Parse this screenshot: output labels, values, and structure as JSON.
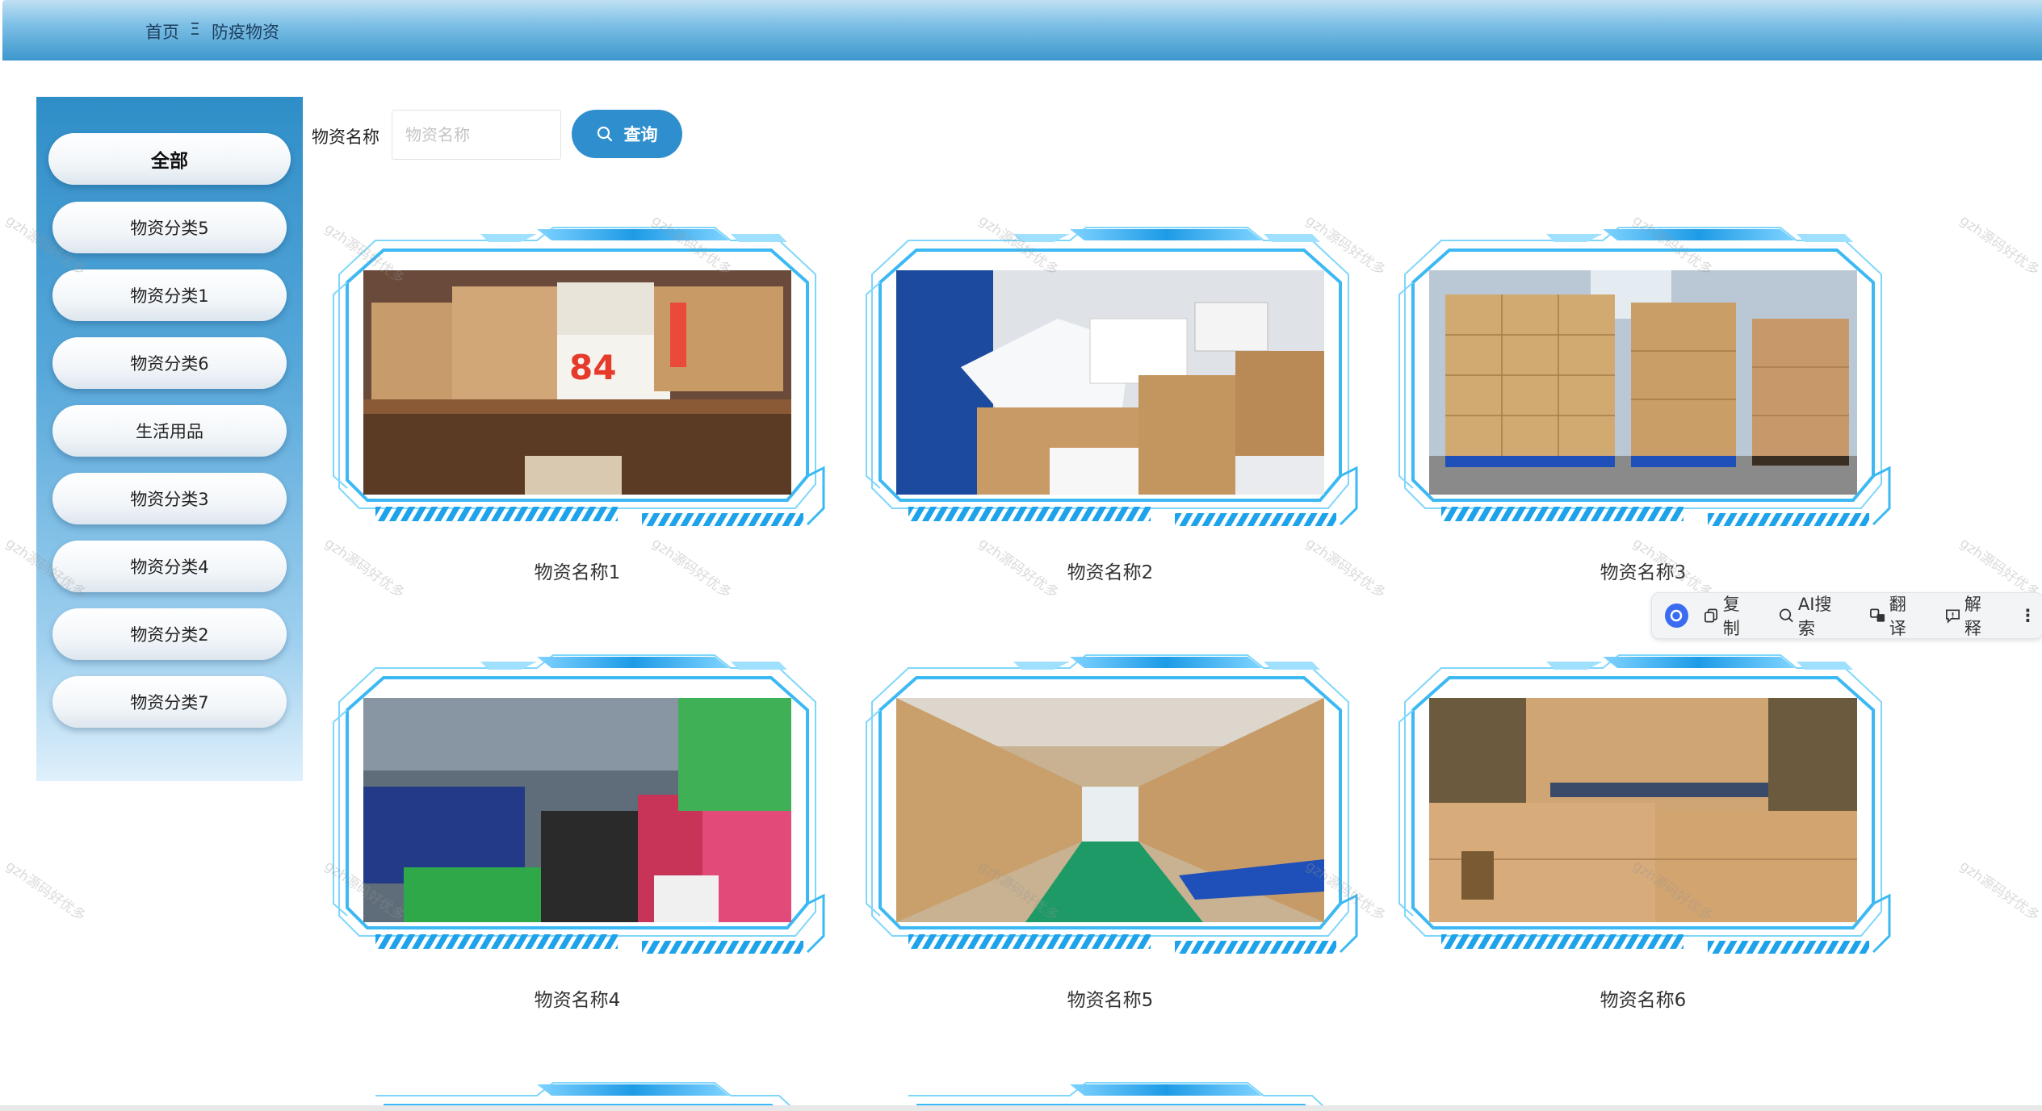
{
  "breadcrumb": {
    "home": "首页",
    "separator": "Ξ",
    "current": "防疫物资"
  },
  "sidebar": {
    "categories": [
      "全部",
      "物资分类5",
      "物资分类1",
      "物资分类6",
      "生活用品",
      "物资分类3",
      "物资分类4",
      "物资分类2",
      "物资分类7"
    ],
    "active_index": 0
  },
  "search": {
    "label": "物资名称",
    "placeholder": "物资名称",
    "value": "",
    "button_label": "查询",
    "button_icon": "search-icon"
  },
  "items": [
    {
      "name": "物资名称1"
    },
    {
      "name": "物资名称2"
    },
    {
      "name": "物资名称3"
    },
    {
      "name": "物资名称4"
    },
    {
      "name": "物资名称5"
    },
    {
      "name": "物资名称6"
    }
  ],
  "toolbar": {
    "copy": "复制",
    "ai_search": "AI搜索",
    "translate": "翻译",
    "explain": "解释",
    "more": "⋮"
  },
  "watermark": "gzh源码好优多",
  "colors": {
    "topbar": "#3d97cc",
    "accent": "#2f8fce",
    "frame": "#29b6f6"
  }
}
